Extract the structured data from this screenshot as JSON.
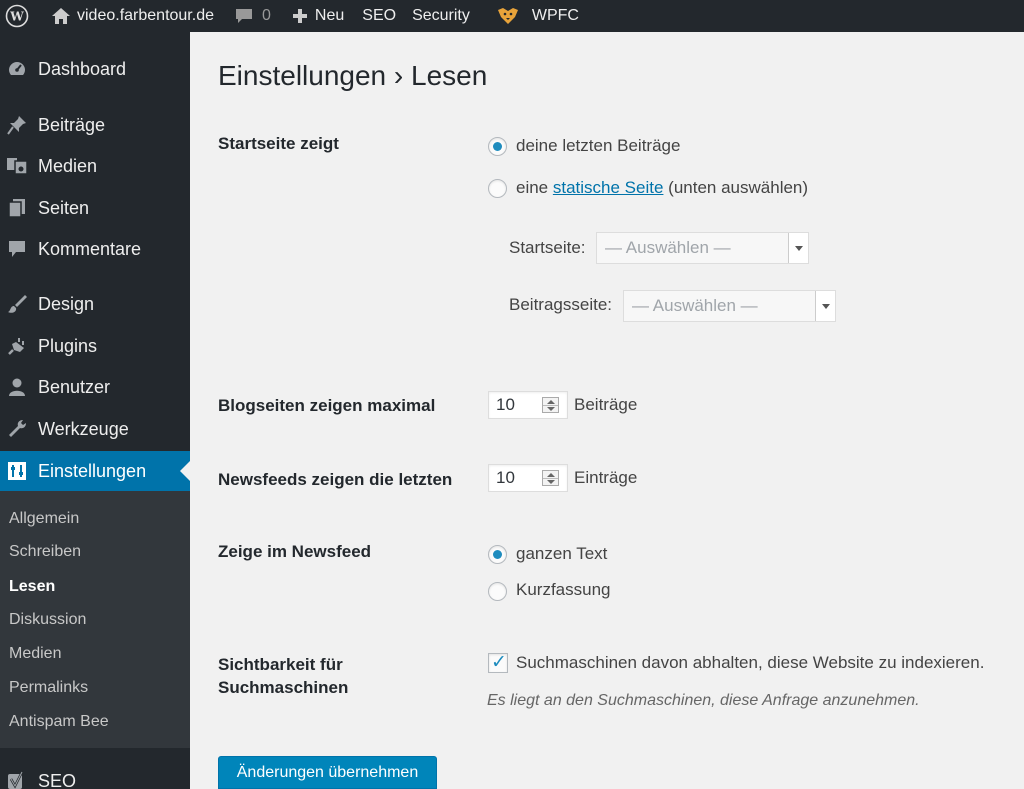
{
  "adminbar": {
    "site_name": "video.farbentour.de",
    "comments_count": "0",
    "new_label": "Neu",
    "seo_label": "SEO",
    "security_label": "Security",
    "wpfc_label": "WPFC"
  },
  "sidebar": {
    "items": [
      {
        "label": "Dashboard",
        "icon": "dashboard-icon"
      },
      {
        "label": "Beiträge",
        "icon": "pin-icon"
      },
      {
        "label": "Medien",
        "icon": "media-icon"
      },
      {
        "label": "Seiten",
        "icon": "pages-icon"
      },
      {
        "label": "Kommentare",
        "icon": "comment-icon"
      },
      {
        "label": "Design",
        "icon": "brush-icon"
      },
      {
        "label": "Plugins",
        "icon": "plug-icon"
      },
      {
        "label": "Benutzer",
        "icon": "user-icon"
      },
      {
        "label": "Werkzeuge",
        "icon": "wrench-icon"
      },
      {
        "label": "Einstellungen",
        "icon": "settings-icon"
      },
      {
        "label": "SEO",
        "icon": "yoast-icon"
      }
    ],
    "submenu": [
      "Allgemein",
      "Schreiben",
      "Lesen",
      "Diskussion",
      "Medien",
      "Permalinks",
      "Antispam Bee"
    ]
  },
  "page": {
    "title": "Einstellungen › Lesen",
    "front_page": {
      "label": "Startseite zeigt",
      "option_latest": "deine letzten Beiträge",
      "option_static_prefix": "eine",
      "option_static_link": "statische Seite",
      "option_static_suffix": "(unten auswählen)",
      "homepage_label": "Startseite:",
      "homepage_value": "— Auswählen —",
      "postspage_label": "Beitragsseite:",
      "postspage_value": "— Auswählen —"
    },
    "blog_pages": {
      "label": "Blogseiten zeigen maximal",
      "value": "10",
      "unit": "Beiträge"
    },
    "feeds": {
      "label": "Newsfeeds zeigen die letzten",
      "value": "10",
      "unit": "Einträge"
    },
    "feed_content": {
      "label": "Zeige im Newsfeed",
      "option_full": "ganzen Text",
      "option_summary": "Kurzfassung"
    },
    "visibility": {
      "label_line1": "Sichtbarkeit für",
      "label_line2": "Suchmaschinen",
      "checkbox_label": "Suchmaschinen davon abhalten, diese Website zu indexieren.",
      "description": "Es liegt an den Suchmaschinen, diese Anfrage anzunehmen."
    },
    "submit_label": "Änderungen übernehmen"
  }
}
